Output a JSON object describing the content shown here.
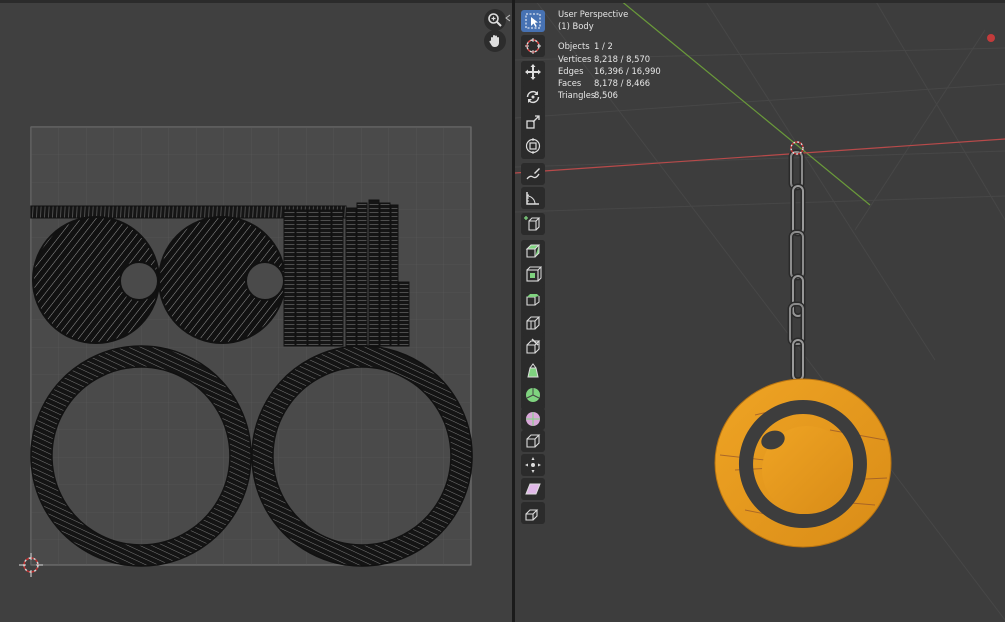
{
  "viewport": {
    "view_name": "User Perspective",
    "object_name": "(1) Body",
    "stats": [
      {
        "key": "Objects",
        "value": "1 / 2"
      },
      {
        "key": "Vertices",
        "value": "8,218 / 8,570"
      },
      {
        "key": "Edges",
        "value": "16,396 / 16,990"
      },
      {
        "key": "Faces",
        "value": "8,178 / 8,466"
      },
      {
        "key": "Triangles",
        "value": "8,506"
      }
    ]
  },
  "icons": {
    "uv_nav": [
      "zoom-icon",
      "hand-pan-icon"
    ],
    "toolbar": [
      "select-box-icon",
      "cursor-icon",
      "move-icon",
      "rotate-icon",
      "scale-icon",
      "transform-icon",
      "annotate-icon",
      "measure-icon",
      "add-cube-icon",
      "extrude-icon",
      "inset-icon",
      "bevel-icon",
      "loop-cut-icon",
      "knife-icon",
      "poly-build-icon",
      "spin-icon",
      "smooth-icon",
      "edge-slide-icon",
      "shrink-fatten-icon",
      "shear-icon",
      "rip-icon"
    ]
  },
  "colors": {
    "uv_background": "#404040",
    "viewport_background": "#3d3d3d",
    "active_tool": "#4772b3",
    "pendant": "#e89a1e",
    "x_axis": "#b84a4a",
    "y_axis": "#6a9a3a"
  }
}
